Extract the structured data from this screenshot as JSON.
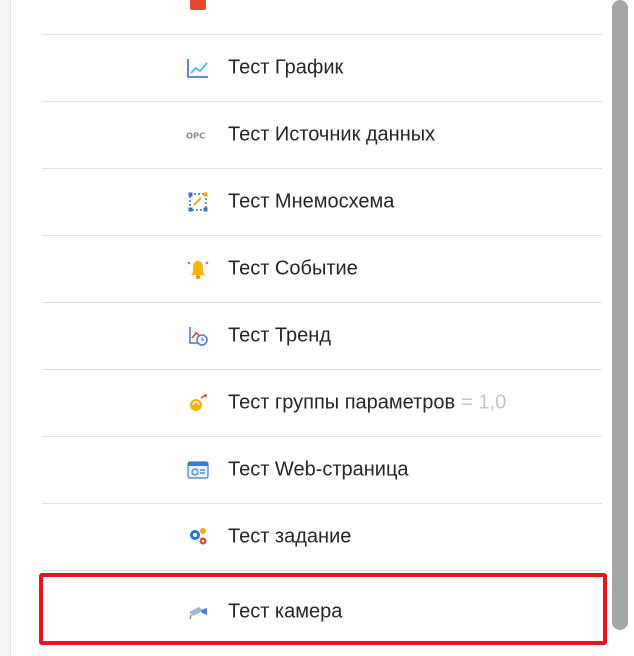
{
  "list": {
    "items": [
      {
        "label": "",
        "suffix": "",
        "icon": "red-item-icon"
      },
      {
        "label": "Тест График",
        "suffix": "",
        "icon": "chart-line-icon"
      },
      {
        "label": "Тест Источник данных",
        "suffix": "",
        "icon": "opc-datasource-icon"
      },
      {
        "label": "Тест Мнемосхема",
        "suffix": "",
        "icon": "mnemonic-scheme-icon"
      },
      {
        "label": "Тест Событие",
        "suffix": "",
        "icon": "bell-event-icon"
      },
      {
        "label": "Тест Тренд",
        "suffix": "",
        "icon": "trend-clock-icon"
      },
      {
        "label": "Тест группы параметров",
        "suffix": "= 1,0",
        "icon": "parameter-group-icon"
      },
      {
        "label": "Тест Web-страница",
        "suffix": "",
        "icon": "web-page-icon"
      },
      {
        "label": "Тест задание",
        "suffix": "",
        "icon": "gears-task-icon"
      },
      {
        "label": "Тест камера",
        "suffix": "",
        "icon": "camera-icon"
      }
    ]
  },
  "colors": {
    "highlight": "#e8141e",
    "scrollbar": "#a7a7a7",
    "divider": "#e3e3e3",
    "text": "#262626",
    "suffix": "#c4c4c4"
  }
}
